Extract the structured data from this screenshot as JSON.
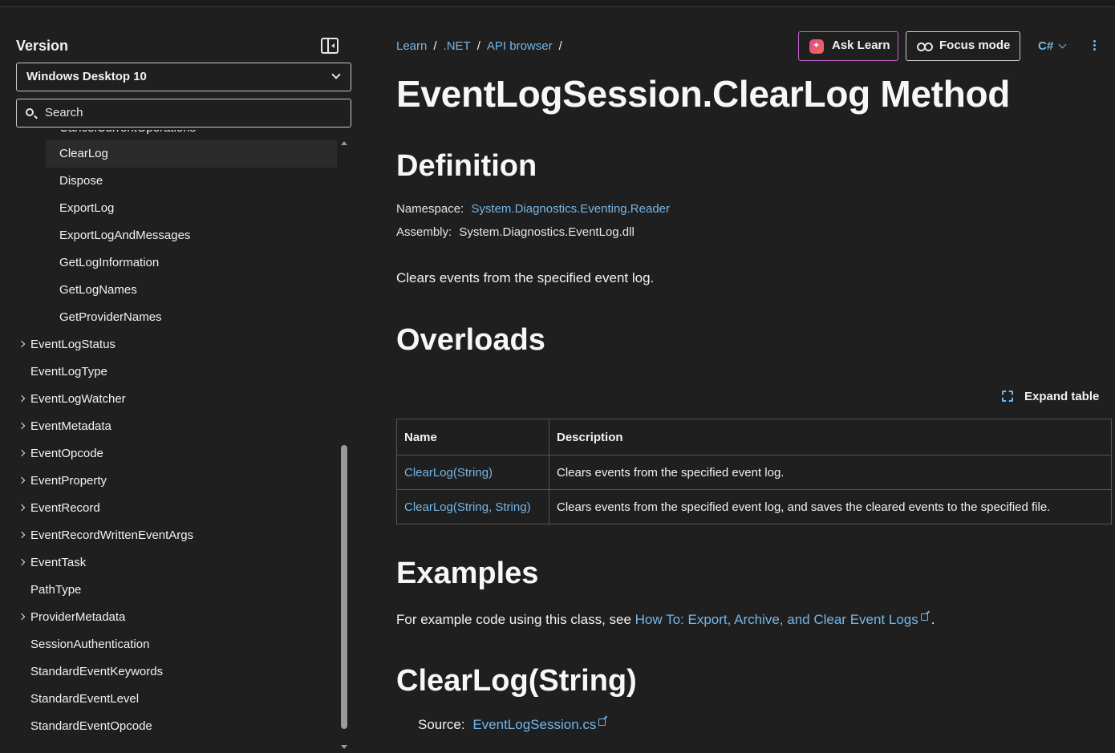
{
  "sidebar": {
    "title": "Version",
    "version_selected": "Windows Desktop 10",
    "search_placeholder": "Search",
    "items": [
      {
        "label": "CancelCurrentOperations",
        "level": 2,
        "expandable": false,
        "selected": false
      },
      {
        "label": "ClearLog",
        "level": 2,
        "expandable": false,
        "selected": true
      },
      {
        "label": "Dispose",
        "level": 2,
        "expandable": false,
        "selected": false
      },
      {
        "label": "ExportLog",
        "level": 2,
        "expandable": false,
        "selected": false
      },
      {
        "label": "ExportLogAndMessages",
        "level": 2,
        "expandable": false,
        "selected": false
      },
      {
        "label": "GetLogInformation",
        "level": 2,
        "expandable": false,
        "selected": false
      },
      {
        "label": "GetLogNames",
        "level": 2,
        "expandable": false,
        "selected": false
      },
      {
        "label": "GetProviderNames",
        "level": 2,
        "expandable": false,
        "selected": false
      },
      {
        "label": "EventLogStatus",
        "level": 1,
        "expandable": true,
        "selected": false
      },
      {
        "label": "EventLogType",
        "level": 1,
        "expandable": false,
        "selected": false
      },
      {
        "label": "EventLogWatcher",
        "level": 1,
        "expandable": true,
        "selected": false
      },
      {
        "label": "EventMetadata",
        "level": 1,
        "expandable": true,
        "selected": false
      },
      {
        "label": "EventOpcode",
        "level": 1,
        "expandable": true,
        "selected": false
      },
      {
        "label": "EventProperty",
        "level": 1,
        "expandable": true,
        "selected": false
      },
      {
        "label": "EventRecord",
        "level": 1,
        "expandable": true,
        "selected": false
      },
      {
        "label": "EventRecordWrittenEventArgs",
        "level": 1,
        "expandable": true,
        "selected": false
      },
      {
        "label": "EventTask",
        "level": 1,
        "expandable": true,
        "selected": false
      },
      {
        "label": "PathType",
        "level": 1,
        "expandable": false,
        "selected": false
      },
      {
        "label": "ProviderMetadata",
        "level": 1,
        "expandable": true,
        "selected": false
      },
      {
        "label": "SessionAuthentication",
        "level": 1,
        "expandable": false,
        "selected": false
      },
      {
        "label": "StandardEventKeywords",
        "level": 1,
        "expandable": false,
        "selected": false
      },
      {
        "label": "StandardEventLevel",
        "level": 1,
        "expandable": false,
        "selected": false
      },
      {
        "label": "StandardEventOpcode",
        "level": 1,
        "expandable": false,
        "selected": false
      }
    ]
  },
  "breadcrumb": [
    "Learn",
    ".NET",
    "API browser"
  ],
  "header": {
    "ask_learn": "Ask Learn",
    "focus_mode": "Focus mode",
    "language": "C#"
  },
  "page": {
    "title": "EventLogSession.ClearLog Method",
    "definition_heading": "Definition",
    "namespace_label": "Namespace:",
    "namespace_value": "System.Diagnostics.Eventing.Reader",
    "assembly_label": "Assembly:",
    "assembly_value": "System.Diagnostics.EventLog.dll",
    "summary": "Clears events from the specified event log.",
    "overloads_heading": "Overloads",
    "expand_table": "Expand table",
    "table": {
      "headers": [
        "Name",
        "Description"
      ],
      "rows": [
        {
          "name": "ClearLog(String)",
          "description": "Clears events from the specified event log."
        },
        {
          "name": "ClearLog(String, String)",
          "description": "Clears events from the specified event log, and saves the cleared events to the specified file."
        }
      ]
    },
    "examples_heading": "Examples",
    "examples_text": "For example code using this class, see ",
    "examples_link": "How To: Export, Archive, and Clear Event Logs",
    "examples_end": ".",
    "clearlog_heading": "ClearLog(String)",
    "source_label": "Source:",
    "source_link": "EventLogSession.cs"
  },
  "colors": {
    "background": "#1f1f1f",
    "link": "#75b6e7",
    "ask_learn_border": "#c063c7",
    "selected_row": "#2b2b2b"
  }
}
